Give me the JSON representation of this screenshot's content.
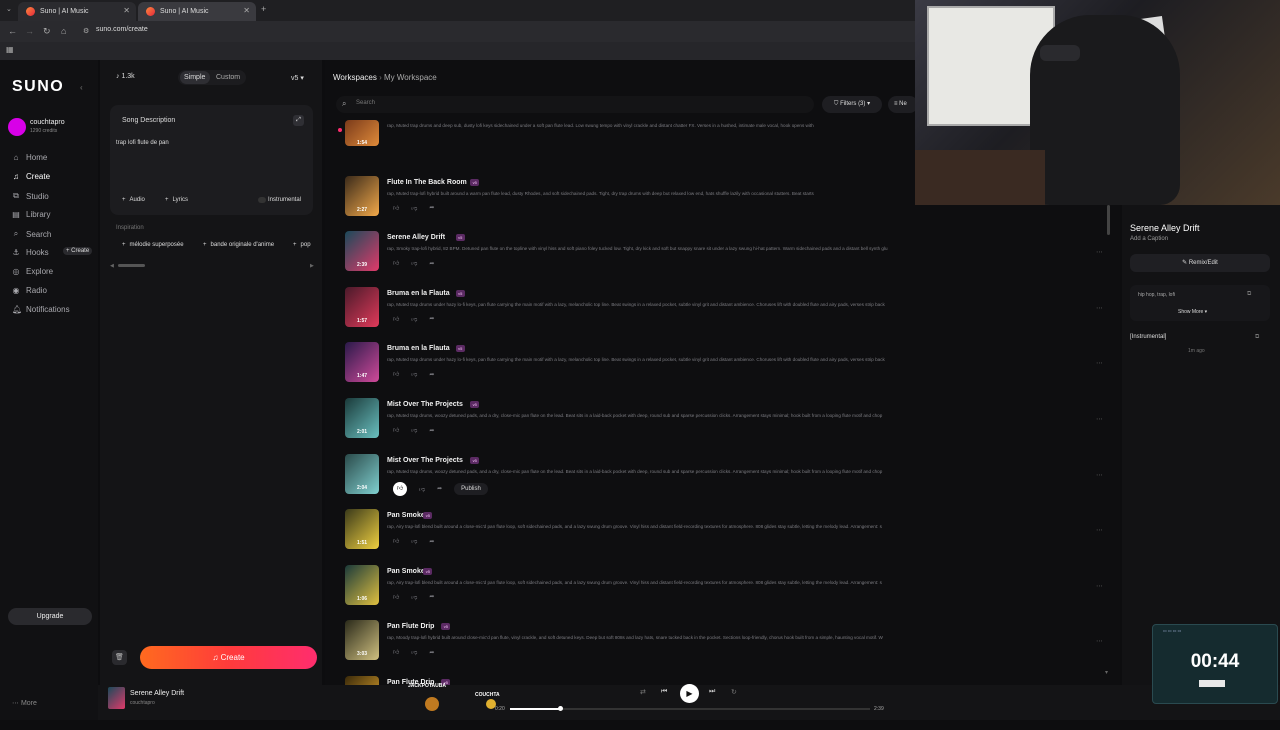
{
  "browser": {
    "tabs": [
      {
        "label": "Suno | AI Music"
      },
      {
        "label": "Suno | AI Music"
      }
    ],
    "url": "suno.com/create"
  },
  "sidebar": {
    "logo": "SUNO",
    "user": {
      "name": "couchtapro",
      "credits": "1290 credits"
    },
    "items": [
      {
        "label": "Home",
        "icon": "home-icon"
      },
      {
        "label": "Create",
        "icon": "music-icon"
      },
      {
        "label": "Studio",
        "icon": "studio-icon"
      },
      {
        "label": "Library",
        "icon": "library-icon"
      },
      {
        "label": "Search",
        "icon": "search-icon"
      },
      {
        "label": "Hooks",
        "icon": "hooks-icon"
      },
      {
        "label": "Explore",
        "icon": "compass-icon"
      },
      {
        "label": "Radio",
        "icon": "radio-icon"
      },
      {
        "label": "Notifications",
        "icon": "bell-icon"
      }
    ],
    "hooks_create": "+ Create",
    "upgrade": "Upgrade",
    "more": "More"
  },
  "composer": {
    "count": "1.3k",
    "modes": [
      "Simple",
      "Custom"
    ],
    "version": "v5",
    "song_description_label": "Song Description",
    "prompt": "trap lofi flute de pan",
    "audio": "Audio",
    "lyrics": "Lyrics",
    "instrumental": "Instrumental",
    "inspiration_label": "Inspiration",
    "inspiration": [
      "mélodie superposée",
      "bande originale d'anime",
      "pop"
    ],
    "create_button": "Create"
  },
  "list": {
    "breadcrumb": [
      "Workspaces",
      "My Workspace"
    ],
    "search_placeholder": "Search",
    "filters": "Filters (3)",
    "sort_partial": "Ne",
    "songs": [
      {
        "title": "",
        "duration": "1:54",
        "desc": "rap, Muted trap drums and deep sub, dusty lofi keys sidechained under a soft pan flute lead. Low swung tempo with vinyl crackle and distant chatter FX. Verses in a hushed, intimate male vocal, hook opens with",
        "colors": [
          "#7a3a1a",
          "#e08b3a"
        ],
        "publish": false
      },
      {
        "title": "Flute In The Back Room",
        "duration": "2:27",
        "desc": "rap, Muted trap-lofi hybrid built around a warm pan flute lead, dusty Rhodes, and soft sidechained pads. Tight, dry trap drums with deep but relaxed low end, hats shuffle lazily with occasional stutters. Beat starts",
        "colors": [
          "#3a2a1a",
          "#f2a94a"
        ],
        "publish": false
      },
      {
        "title": "Serene Alley Drift",
        "duration": "2:39",
        "desc": "rap, Smoky trap-lofi hybrid, 82 BPM. Detuned pan flute on the topline with vinyl hiss and soft piano foley tucked low. Tight, dry kick and soft but snappy snare sit under a lazy swung hi-hat pattern. Warm sidechained pads and a distant bell synth glu",
        "colors": [
          "#1a4a5a",
          "#e03a6a"
        ],
        "publish": false
      },
      {
        "title": "Bruma en la Flauta",
        "duration": "1:57",
        "desc": "rap, Muted trap drums under hazy lo-fi keys, pan flute carrying the main motif with a lazy, melancholic top line. Beat swings in a relaxed pocket, subtle vinyl grit and distant ambience. Choruses lift with doubled flute and airy pads, verses strip back",
        "colors": [
          "#4a1a2a",
          "#e03a5a"
        ],
        "publish": false
      },
      {
        "title": "Bruma en la Flauta",
        "duration": "1:47",
        "desc": "rap, Muted trap drums under hazy lo-fi keys, pan flute carrying the main motif with a lazy, melancholic top line. Beat swings in a relaxed pocket, subtle vinyl grit and distant ambience. Choruses lift with doubled flute and airy pads, verses strip back",
        "colors": [
          "#2a1a4a",
          "#d04a9a"
        ],
        "publish": false
      },
      {
        "title": "Mist Over The Projects",
        "duration": "2:01",
        "desc": "rap, Muted trap drums, woozy detuned pads, and a dry, close-mic pan flute on the lead. Beat sits in a laid-back pocket with deep, round sub and sparse percussion clicks. Arrangement stays minimal; hook built from a looping flute motif and chop",
        "colors": [
          "#1a3a3a",
          "#6ac0c0"
        ],
        "publish": false
      },
      {
        "title": "Mist Over The Projects",
        "duration": "2:04",
        "desc": "rap, Muted trap drums, woozy detuned pads, and a dry, close-mic pan flute on the lead. Beat sits in a laid-back pocket with deep, round sub and sparse percussion clicks. Arrangement stays minimal; hook built from a looping flute motif and chop",
        "colors": [
          "#2a4a4a",
          "#80d0d0"
        ],
        "publish": true
      },
      {
        "title": "Pan Smoke",
        "duration": "1:51",
        "desc": "rap, Airy trap-lofi blend built around a close-mic'd pan flute loop, soft sidechained pads, and a lazy swung drum groove. Vinyl hiss and distant field-recording textures for atmosphere. 808 glides stay subtle, letting the melody lead. Arrangement: s",
        "colors": [
          "#3a3a1a",
          "#f0d040"
        ],
        "publish": false
      },
      {
        "title": "Pan Smoke",
        "duration": "1:06",
        "desc": "rap, Airy trap-lofi blend built around a close-mic'd pan flute loop, soft sidechained pads, and a lazy swung drum groove. Vinyl hiss and distant field-recording textures for atmosphere. 808 glides stay subtle, letting the melody lead. Arrangement: s",
        "colors": [
          "#1a3a3a",
          "#e0c040"
        ],
        "publish": false
      },
      {
        "title": "Pan Flute Drip",
        "duration": "3:03",
        "desc": "rap, Moody trap-lofi hybrid built around close-mic'd pan flute, vinyl crackle, and soft detuned keys. Deep but soft 808s and lazy hats, snare tucked back in the pocket. Sections loop-friendly, chorus hook built from a simple, haunting vocal motif. W",
        "colors": [
          "#2a2a1a",
          "#d0c080"
        ],
        "publish": false
      },
      {
        "title": "Pan Flute Drip",
        "duration": "",
        "desc": "",
        "colors": [
          "#3a2a0a",
          "#f0b030"
        ],
        "publish": false
      }
    ],
    "publish_label": "Publish"
  },
  "right": {
    "title": "Serene Alley Drift",
    "caption": "Add a Caption",
    "remix": "Remix/Edit",
    "tags": "hip hop, trap, lofi",
    "show_more": "Show More",
    "lyrics_label": "[Instrumental]",
    "time_ago": "1m ago"
  },
  "player": {
    "title": "Serene Alley Drift",
    "artist": "couchtapro",
    "current": "0:20",
    "total": "2:39",
    "progress": 0.14,
    "overlay_left": "JACKPOTAUBA",
    "overlay_mid": "COUCHTA"
  },
  "timer": {
    "value": "00:44"
  },
  "colors": {
    "accent": "#ff4d2e",
    "accent2": "#ff2d6e",
    "avatar": "#d800e8"
  }
}
